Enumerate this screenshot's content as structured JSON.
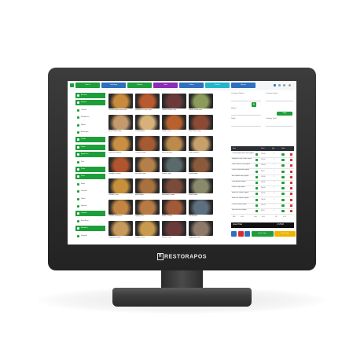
{
  "brand": {
    "name": "RESTORAPOS",
    "mark": "R"
  },
  "pos": {
    "tabs": [
      {
        "label": "Dine In",
        "color": "#1e9e3a"
      },
      {
        "label": "Take Away",
        "color": "#2f6fbf"
      },
      {
        "label": "Delivery",
        "color": "#1e9e3a"
      },
      {
        "label": "Hold",
        "color": "#8e2bb8"
      },
      {
        "label": "Orders",
        "color": "#2f6fbf"
      },
      {
        "label": "Kitchen",
        "color": "#1fb7c9"
      },
      {
        "label": "Reports",
        "color": "#2f6fbf"
      }
    ],
    "categories": [
      {
        "label": "All Items",
        "active": true
      },
      {
        "label": "Burgers",
        "active": true
      },
      {
        "label": "Chicken",
        "active": false
      },
      {
        "label": "Sandwiches",
        "active": false
      },
      {
        "label": "Wraps",
        "active": false
      },
      {
        "label": "Beverages",
        "active": false
      },
      {
        "label": "Salads",
        "active": true
      },
      {
        "label": "Soups",
        "active": true
      },
      {
        "label": "Appetizers",
        "active": true
      },
      {
        "label": "Rice",
        "active": false
      },
      {
        "label": "Pasta",
        "active": true
      },
      {
        "label": "Pizza",
        "active": true
      },
      {
        "label": "Sides",
        "active": false
      },
      {
        "label": "Desserts",
        "active": false
      },
      {
        "label": "Drinks",
        "active": false
      },
      {
        "label": "Specials",
        "active": false
      },
      {
        "label": "Combos",
        "active": true
      },
      {
        "label": "Kids Menu",
        "active": false
      },
      {
        "label": "Breakfast",
        "active": true
      },
      {
        "label": "Seafood",
        "active": false
      }
    ],
    "menu_items": [
      {
        "caption": "Chicken Biryani with Raita",
        "tone": "#c88a3c"
      },
      {
        "caption": "Margherita Pizza Large",
        "tone": "#b95a2e"
      },
      {
        "caption": "Grilled Salmon Plate",
        "tone": "#6a3a3a"
      },
      {
        "caption": "Caesar Salad Bowl",
        "tone": "#8c9a5a"
      },
      {
        "caption": "Beef Noodle Soup",
        "tone": "#c49a6c"
      },
      {
        "caption": "Pasta Alfredo",
        "tone": "#d6b27a"
      },
      {
        "caption": "Prawn Curry",
        "tone": "#b8612f"
      },
      {
        "caption": "Mixed Grill Platter",
        "tone": "#8a4a34"
      },
      {
        "caption": "Fried Rice Special",
        "tone": "#c98f42"
      },
      {
        "caption": "Chicken Wings",
        "tone": "#a45a33"
      },
      {
        "caption": "Veg Fried Rice",
        "tone": "#bb8a4c"
      },
      {
        "caption": "Club Sandwich",
        "tone": "#c7a06a"
      },
      {
        "caption": "Tandoori Chicken",
        "tone": "#b2542c"
      },
      {
        "caption": "Fish and Chips",
        "tone": "#b4804a"
      },
      {
        "caption": "Paneer Tikka",
        "tone": "#5a6a6a"
      },
      {
        "caption": "Lamb Kebab",
        "tone": "#8b5a3a"
      },
      {
        "caption": "Chicken Curry",
        "tone": "#c7903a"
      },
      {
        "caption": "Beef Burger",
        "tone": "#a8713e"
      },
      {
        "caption": "Mushroom Risotto",
        "tone": "#7a4a3a"
      },
      {
        "caption": "Greek Salad",
        "tone": "#8a8a6a"
      },
      {
        "caption": "Chicken Shawarma",
        "tone": "#c28642"
      },
      {
        "caption": "Spring Rolls",
        "tone": "#b87a44"
      },
      {
        "caption": "Butter Chicken",
        "tone": "#a05a3a"
      },
      {
        "caption": "Dal Makhani",
        "tone": "#5e7080"
      },
      {
        "caption": "Vegetable Biryani",
        "tone": "#c59a5a"
      },
      {
        "caption": "Shrimp Pasta",
        "tone": "#c79a4e"
      },
      {
        "caption": "Mutton Curry",
        "tone": "#6a3a3a"
      },
      {
        "caption": "Pepperoni Pizza",
        "tone": "#8e7a6a"
      }
    ],
    "form": {
      "customer_label": "Customer Name*",
      "customer_type_label": "Customer Type*",
      "waiter_label": "Waiter*",
      "table_label": "Table*",
      "cooking_time_label": "Cooking Time*",
      "add_label": "+",
      "apply_label": "Apply"
    },
    "order_headers": {
      "item": "Item",
      "price": "Price",
      "qty": "Qty",
      "total": "Total"
    },
    "order_rows": [
      {
        "name": "Chicken Biryani with Raita Regular",
        "price": "120.00",
        "qty": "1"
      },
      {
        "name": "Margherita Pizza Large Cheese",
        "price": "250.00",
        "qty": "1"
      },
      {
        "name": "Grilled Salmon Plate Regular",
        "price": "180.00",
        "qty": "1"
      },
      {
        "name": "Caesar Salad Bowl Regular",
        "price": "90.00",
        "qty": "1"
      },
      {
        "name": "Beef Noodle Soup Regular",
        "price": "110.00",
        "qty": "1"
      },
      {
        "name": "Pasta Alfredo Regular",
        "price": "140.00",
        "qty": "1"
      },
      {
        "name": "Prawn Curry Regular",
        "price": "200.00",
        "qty": "1"
      },
      {
        "name": "Mixed Grill Platter Regular",
        "price": "320.00",
        "qty": "1"
      },
      {
        "name": "Fried Rice Special Regular",
        "price": "100.00",
        "qty": "1"
      },
      {
        "name": "Chicken Wings Regular",
        "price": "130.00",
        "qty": "1"
      },
      {
        "name": "Veg Fried Rice Regular",
        "price": "85.00",
        "qty": "1"
      }
    ],
    "totals": [
      {
        "label": "VAT",
        "value": "0.00"
      },
      {
        "label": "Disc",
        "value": "0.00"
      },
      {
        "label": "SC",
        "value": "0.00"
      }
    ],
    "grand_total": {
      "label": "Grand Total",
      "value": "1,725.00"
    },
    "actions": [
      {
        "label": "",
        "color": "#2f6fbf",
        "name": "calculator-button"
      },
      {
        "label": "",
        "color": "#e02828",
        "name": "cancel-button"
      },
      {
        "label": "",
        "color": "#2f6fbf",
        "name": "print-button"
      },
      {
        "label": "Quick Order",
        "color": "#1e9e3a",
        "name": "quick-order-button"
      },
      {
        "label": "Place Order",
        "color": "#f0b400",
        "name": "place-order-button"
      }
    ]
  }
}
